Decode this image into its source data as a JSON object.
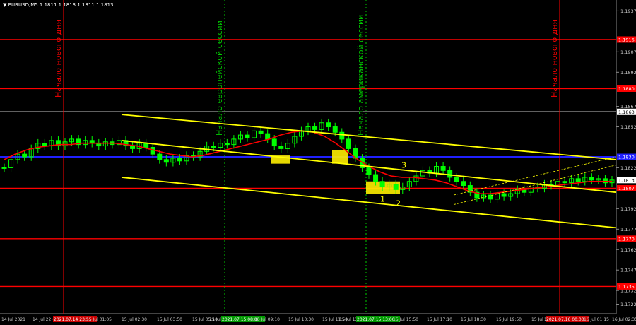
{
  "symbol_info": "▼ EURUSD,M5  1.1811 1.1813 1.1811 1.1813",
  "colors": {
    "background": "#000000",
    "candle": "#00ff00",
    "ma": "#ff0000",
    "channel": "#ffff00",
    "level_red": "#ff0000",
    "level_blue": "#2020ff",
    "level_white": "#ffffff",
    "vline_red": "#ff0000",
    "vline_green": "#00cc00",
    "highlight_box": "#ffee00"
  },
  "annotations": [
    {
      "text": "Начало нового дня",
      "color": "#ff0000",
      "date": "14 Jul 2021 23:55"
    },
    {
      "text": "Начало европейской сессии",
      "color": "#00cc00",
      "date": "15 Jul 2021 08:00"
    },
    {
      "text": "Начало американской сессии",
      "color": "#00cc00",
      "date": "15 Jul 2021 13:00"
    },
    {
      "text": "Начало нового дня",
      "color": "#ff0000",
      "date": "16 Jul 2021 00:00"
    }
  ],
  "signal_labels": [
    "1",
    "2",
    "3"
  ],
  "price_labels": {
    "grid": [
      "1.1937",
      "1.1907",
      "1.1892",
      "1.1867",
      "1.1852",
      "1.1822",
      "1.1792",
      "1.1777",
      "1.1762",
      "1.1747",
      "1.1732",
      "1.1722"
    ],
    "current": "1.1813",
    "level_red": [
      "1.1916",
      "1.1880",
      "1.1807",
      "1.1770",
      "1.1735"
    ],
    "level_blue": "1.1830",
    "level_white": "1.1863"
  },
  "time_labels": [
    {
      "text": "14 Jul 2021",
      "highlight": false
    },
    {
      "text": "14 Jul 22:05",
      "highlight": false
    },
    {
      "text": "2021.07.14 23:55",
      "highlight": true
    },
    {
      "text": "15 Jul 01:05",
      "highlight": false
    },
    {
      "text": "15 Jul 02:30",
      "highlight": false
    },
    {
      "text": "15 Jul 03:50",
      "highlight": false
    },
    {
      "text": "15 Jul 05:10",
      "highlight": false
    },
    {
      "text": "15 Jul 0",
      "highlight": false
    },
    {
      "text": "2021.07.15 08:00",
      "highlight": true
    },
    {
      "text": "15 Jul 09:10",
      "highlight": false
    },
    {
      "text": "15 Jul 10:30",
      "highlight": false
    },
    {
      "text": "15 Jul 11:50",
      "highlight": false
    },
    {
      "text": "15 Jul 13:10",
      "highlight": false
    },
    {
      "text": "2021.07.15 13:00",
      "highlight": true
    },
    {
      "text": "15 Jul 15:50",
      "highlight": false
    },
    {
      "text": "15 Jul 17:10",
      "highlight": false
    },
    {
      "text": "15 Jul 18:30",
      "highlight": false
    },
    {
      "text": "15 Jul 19:50",
      "highlight": false
    },
    {
      "text": "15 Jul 21:10",
      "highlight": false
    },
    {
      "text": "15 Jul 2",
      "highlight": false
    },
    {
      "text": "2021.07.16 00:00",
      "highlight": true
    },
    {
      "text": "16 Jul 01:15",
      "highlight": false
    },
    {
      "text": "16 Jul 02:35",
      "highlight": false
    }
  ],
  "chart_data": {
    "type": "line",
    "symbol": "EURUSD",
    "timeframe": "M5",
    "ohlc_last": {
      "open": 1.1811,
      "high": 1.1813,
      "low": 1.1811,
      "close": 1.1813
    },
    "ylim": [
      1.1715,
      1.1945
    ],
    "yticks": [
      1.1937,
      1.1907,
      1.1892,
      1.1867,
      1.1852,
      1.1822,
      1.1792,
      1.1777,
      1.1762,
      1.1747,
      1.1732,
      1.1722
    ],
    "grid": false,
    "series": [
      {
        "values": [
          1.1822,
          1.1828,
          1.1832,
          1.183,
          1.1836,
          1.184,
          1.1838,
          1.1842,
          1.1838,
          1.1841,
          1.1843,
          1.1839,
          1.1842,
          1.184,
          1.1838,
          1.1841,
          1.1839,
          1.1842,
          1.1838,
          1.1836,
          1.184,
          1.1837,
          1.1832,
          1.1828,
          1.1826,
          1.1829,
          1.1827,
          1.1831,
          1.183,
          1.1834,
          1.1838,
          1.1837,
          1.184,
          1.1839,
          1.1843,
          1.1846,
          1.1844,
          1.1849,
          1.1847,
          1.1843,
          1.1838,
          1.1836,
          1.184,
          1.1845,
          1.1849,
          1.1852,
          1.185,
          1.1855,
          1.1852,
          1.1848,
          1.1843,
          1.1836,
          1.1829,
          1.1822,
          1.1817,
          1.1812,
          1.1808,
          1.181,
          1.1806,
          1.1808,
          1.1812,
          1.1816,
          1.182,
          1.1818,
          1.1823,
          1.182,
          1.1815,
          1.1812,
          1.1809,
          1.1804,
          1.18,
          1.1802,
          1.1799,
          1.1803,
          1.1801,
          1.1803,
          1.1806,
          1.1804,
          1.1808,
          1.1807,
          1.181,
          1.1809,
          1.1812,
          1.1811,
          1.1814,
          1.1812,
          1.1815,
          1.1813,
          1.1814,
          1.1811,
          1.1813
        ]
      },
      {
        "values": [
          1.1828,
          1.1832,
          1.1835,
          1.1837,
          1.1838,
          1.1839,
          1.1839,
          1.184,
          1.184,
          1.184,
          1.184,
          1.1839,
          1.1838,
          1.1836,
          1.1834,
          1.1832,
          1.1831,
          1.183,
          1.1831,
          1.1833,
          1.1835,
          1.1837,
          1.1839,
          1.1841,
          1.1843,
          1.1846,
          1.1848,
          1.1849,
          1.1848,
          1.1845,
          1.184,
          1.1834,
          1.1828,
          1.1823,
          1.1819,
          1.1816,
          1.1815,
          1.1815,
          1.1814,
          1.1813,
          1.1811,
          1.1808,
          1.1805,
          1.1803,
          1.1803,
          1.1804,
          1.1805,
          1.1806,
          1.1807,
          1.1808,
          1.1809,
          1.181,
          1.1811,
          1.1812,
          1.1812,
          1.1812
        ]
      }
    ],
    "levels": [
      {
        "value": 1.1916,
        "color": "#ff0000"
      },
      {
        "value": 1.188,
        "color": "#ff0000"
      },
      {
        "value": 1.1863,
        "color": "#ffffff"
      },
      {
        "value": 1.183,
        "color": "#2020ff"
      },
      {
        "value": 1.1807,
        "color": "#ff0000"
      },
      {
        "value": 1.177,
        "color": "#ff0000"
      },
      {
        "value": 1.1735,
        "color": "#ff0000"
      }
    ],
    "trendlines": [
      {
        "color": "#ffff00",
        "from": {
          "time": "15 Jul 01:30",
          "price": 1.1861
        },
        "to": {
          "time": "16 Jul 02:35",
          "price": 1.1828
        }
      },
      {
        "color": "#ffff00",
        "from": {
          "time": "15 Jul 01:30",
          "price": 1.1842
        },
        "to": {
          "time": "16 Jul 02:35",
          "price": 1.1804
        }
      },
      {
        "color": "#ffff00",
        "from": {
          "time": "15 Jul 01:30",
          "price": 1.1815
        },
        "to": {
          "time": "16 Jul 02:35",
          "price": 1.1778
        }
      }
    ]
  }
}
